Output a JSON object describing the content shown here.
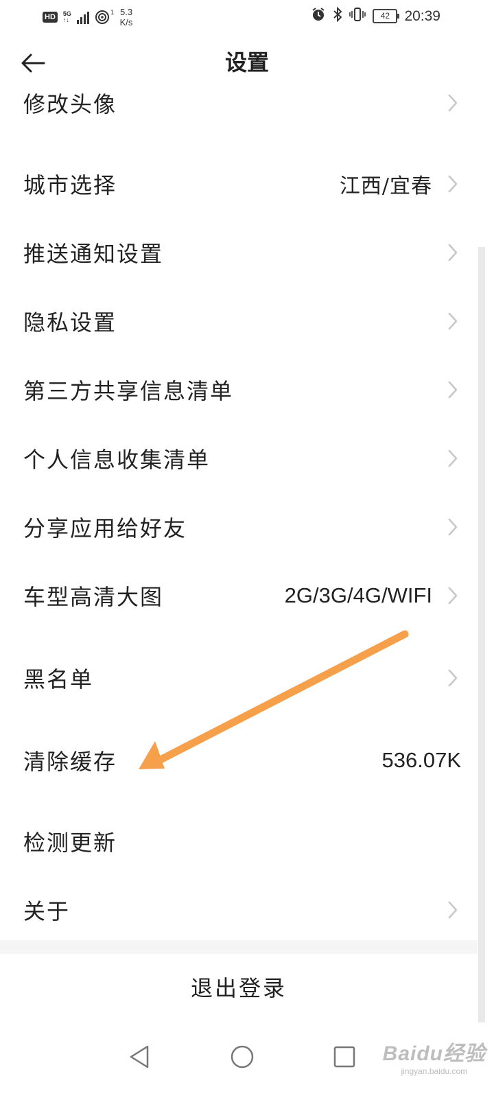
{
  "status_bar": {
    "hd": "HD",
    "net_top": "5G",
    "net_bottom": "↑↓",
    "wifi_sub": "1",
    "speed_value": "5.3",
    "speed_unit": "K/s",
    "battery": "42",
    "time": "20:39"
  },
  "header": {
    "title": "设置",
    "back_icon": "arrow-left-icon"
  },
  "settings": {
    "items": [
      {
        "label": "修改头像",
        "value": "",
        "arrow": true
      },
      {
        "label": "城市选择",
        "value": "江西/宜春",
        "arrow": true
      },
      {
        "label": "推送通知设置",
        "value": "",
        "arrow": true
      },
      {
        "label": "隐私设置",
        "value": "",
        "arrow": true
      },
      {
        "label": "第三方共享信息清单",
        "value": "",
        "arrow": true
      },
      {
        "label": "个人信息收集清单",
        "value": "",
        "arrow": true
      },
      {
        "label": "分享应用给好友",
        "value": "",
        "arrow": true
      },
      {
        "label": "车型高清大图",
        "value": "2G/3G/4G/WIFI",
        "arrow": true
      },
      {
        "label": "黑名单",
        "value": "",
        "arrow": true
      },
      {
        "label": "清除缓存",
        "value": "536.07K",
        "arrow": false
      },
      {
        "label": "检测更新",
        "value": "",
        "arrow": false
      },
      {
        "label": "关于",
        "value": "",
        "arrow": true
      }
    ]
  },
  "logout_label": "退出登录",
  "watermark": {
    "logo": "Baidu经验",
    "sub": "jingyan.baidu.com"
  },
  "colors": {
    "annotation_arrow": "#f7a04b",
    "chevron": "#c8c8c8",
    "divider": "#f5f5f5"
  }
}
